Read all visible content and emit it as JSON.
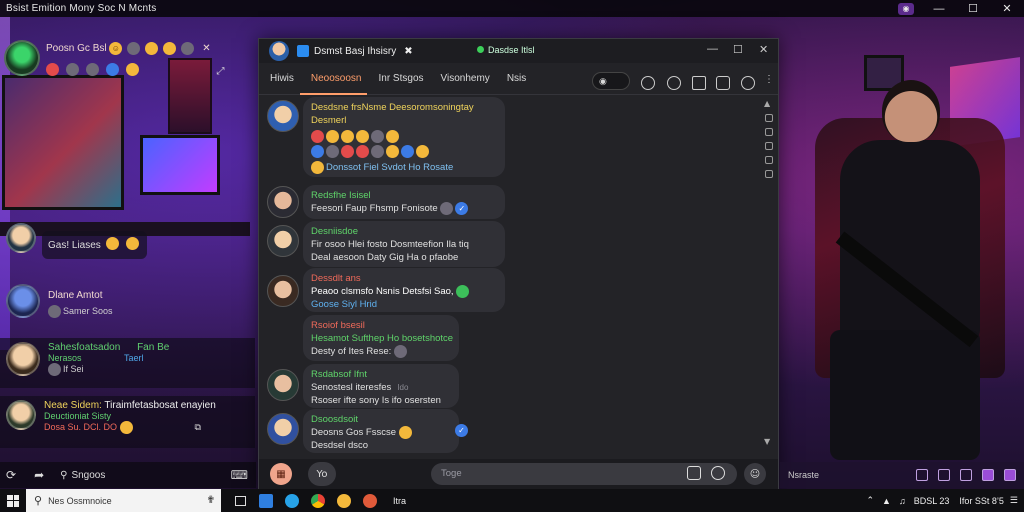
{
  "os_title": "Bsist Emition Mony Soc N Mcnts",
  "topbar_controls": [
    "—",
    "☐",
    "✕"
  ],
  "sidebar": {
    "top_user": {
      "name": "Poosn Gc Bsl",
      "extra_icon": "close-icon"
    },
    "items": [
      {
        "name": "Gas! Liases",
        "sub": "",
        "color": "#e8e8e8"
      },
      {
        "name": "Dlane Amtot",
        "sub": "Samer Soos",
        "color": "#f0d8d0"
      },
      {
        "name": "Sahesfoatsadon",
        "sub": "Nerasos",
        "tail": "Fan Be",
        "tail2": "Taerl",
        "sub2": "If Sei",
        "color": "#60d070"
      },
      {
        "name": "Neae Sidem:",
        "sub": "Tiraimfetasbosat enayien",
        "sub2": "Deuctioniat Sisty",
        "sub3": "Dosa Su. DCl. DO",
        "color": "#f0d45c"
      }
    ]
  },
  "left_tools": {
    "search_label": "Sngoos"
  },
  "window": {
    "title": "Dsmst Basj Ihsisry",
    "status": "Dasdse Itlsl",
    "tabs": [
      "Hiwis",
      "Neoosoosn",
      "Inr Stsgos",
      "Visonhemy",
      "Nsis"
    ],
    "active_tab": 1,
    "messages": [
      {
        "name": "Desdsne frsNsme Deesoromsoningtay",
        "line2": "Desmerl",
        "name_color": "yellow",
        "reactions_row2": "Donssot Fiel Svdot Ho Rosate"
      },
      {
        "name": "Redsfhe Isisel",
        "line2": "Feesori Faup Fhsmp Fonisote",
        "name_color": "green"
      },
      {
        "name": "Desniisdoe",
        "line2": "Fir osoo Hlei fosto Dosmteefion Ila tiq",
        "line3": "Deal aesoon Daty Gig Ha o pfaobe",
        "name_color": "green"
      },
      {
        "name": "Dessdlt ans",
        "line2": "Peaoo clsmsfo Nsnis Detsfsi Sao,",
        "line3": "Goose Siyl Hrid",
        "name_color": "red"
      },
      {
        "name": "Rsoiof bsesil",
        "line2": "Hesamot Sufthep Ho bosetshotce",
        "line3": "Desty of Ites Rese:",
        "name_color": "red"
      },
      {
        "name": "Rsdabsof Ifnt",
        "line2": "Senostesl iteresfes",
        "line3": "Rsoser ifte sony Is ifo osersten",
        "name_color": "green",
        "tstamp": "Ido"
      },
      {
        "name": "Dsoosdsoit",
        "line2": "Deosns Gos Fsscse",
        "line3": "Desdsel dsco",
        "name_color": "green"
      }
    ],
    "composer": {
      "placeholder": "Toge",
      "left_label": "Yo"
    }
  },
  "right_bar": {
    "label": "Nsraste"
  },
  "taskbar": {
    "search": "Nes Ossmnoice",
    "app_label": "Itra",
    "clock": "BDSL 23",
    "date": "Ifor SSt 8’5"
  }
}
